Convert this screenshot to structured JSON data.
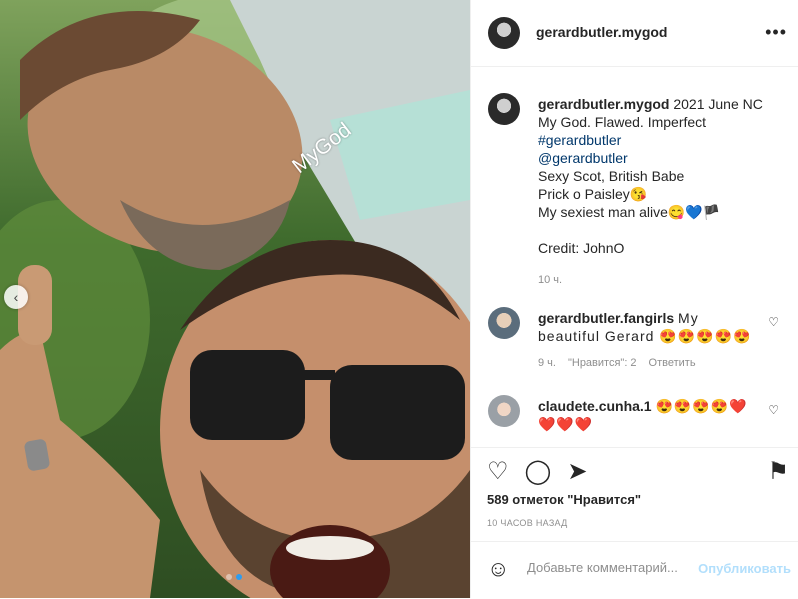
{
  "photo": {
    "watermark": "MyGod",
    "prev_icon": "chevron-left-icon",
    "slides_total": 2,
    "slide_active": 2
  },
  "header": {
    "username": "gerardbutler.mygod",
    "more_icon": "more-horizontal-icon"
  },
  "caption": {
    "username": "gerardbutler.mygod",
    "lines": [
      "2021 June NC",
      "My God. Flawed. Imperfect",
      "#gerardbutler",
      "@gerardbutler",
      "Sexy Scot, British Babe",
      "Prick o Paisley😘",
      "My sexiest man alive😋💙🏴",
      "",
      "Credit: JohnO"
    ],
    "time": "10 ч."
  },
  "comments": [
    {
      "username": "gerardbutler.fangirls",
      "text": "My beautiful Gerard 😍😍😍😍😍",
      "time": "9 ч.",
      "likes": "\"Нравится\": 2",
      "reply": "Ответить"
    },
    {
      "username": "claudete.cunha.1",
      "text": "😍😍😍😍❤️ ❤️❤️❤️"
    }
  ],
  "actions": {
    "likes": "589 отметок \"Нравится\"",
    "time_ago": "10 ЧАСОВ НАЗАД"
  },
  "add_comment": {
    "placeholder": "Добавьте комментарий...",
    "post_label": "Опубликовать"
  },
  "colors": {
    "link": "#00376b",
    "secondary_text": "#8e8e8e",
    "post_button_disabled": "#b2dffc",
    "carousel_dot_active": "#2d9cf0"
  }
}
